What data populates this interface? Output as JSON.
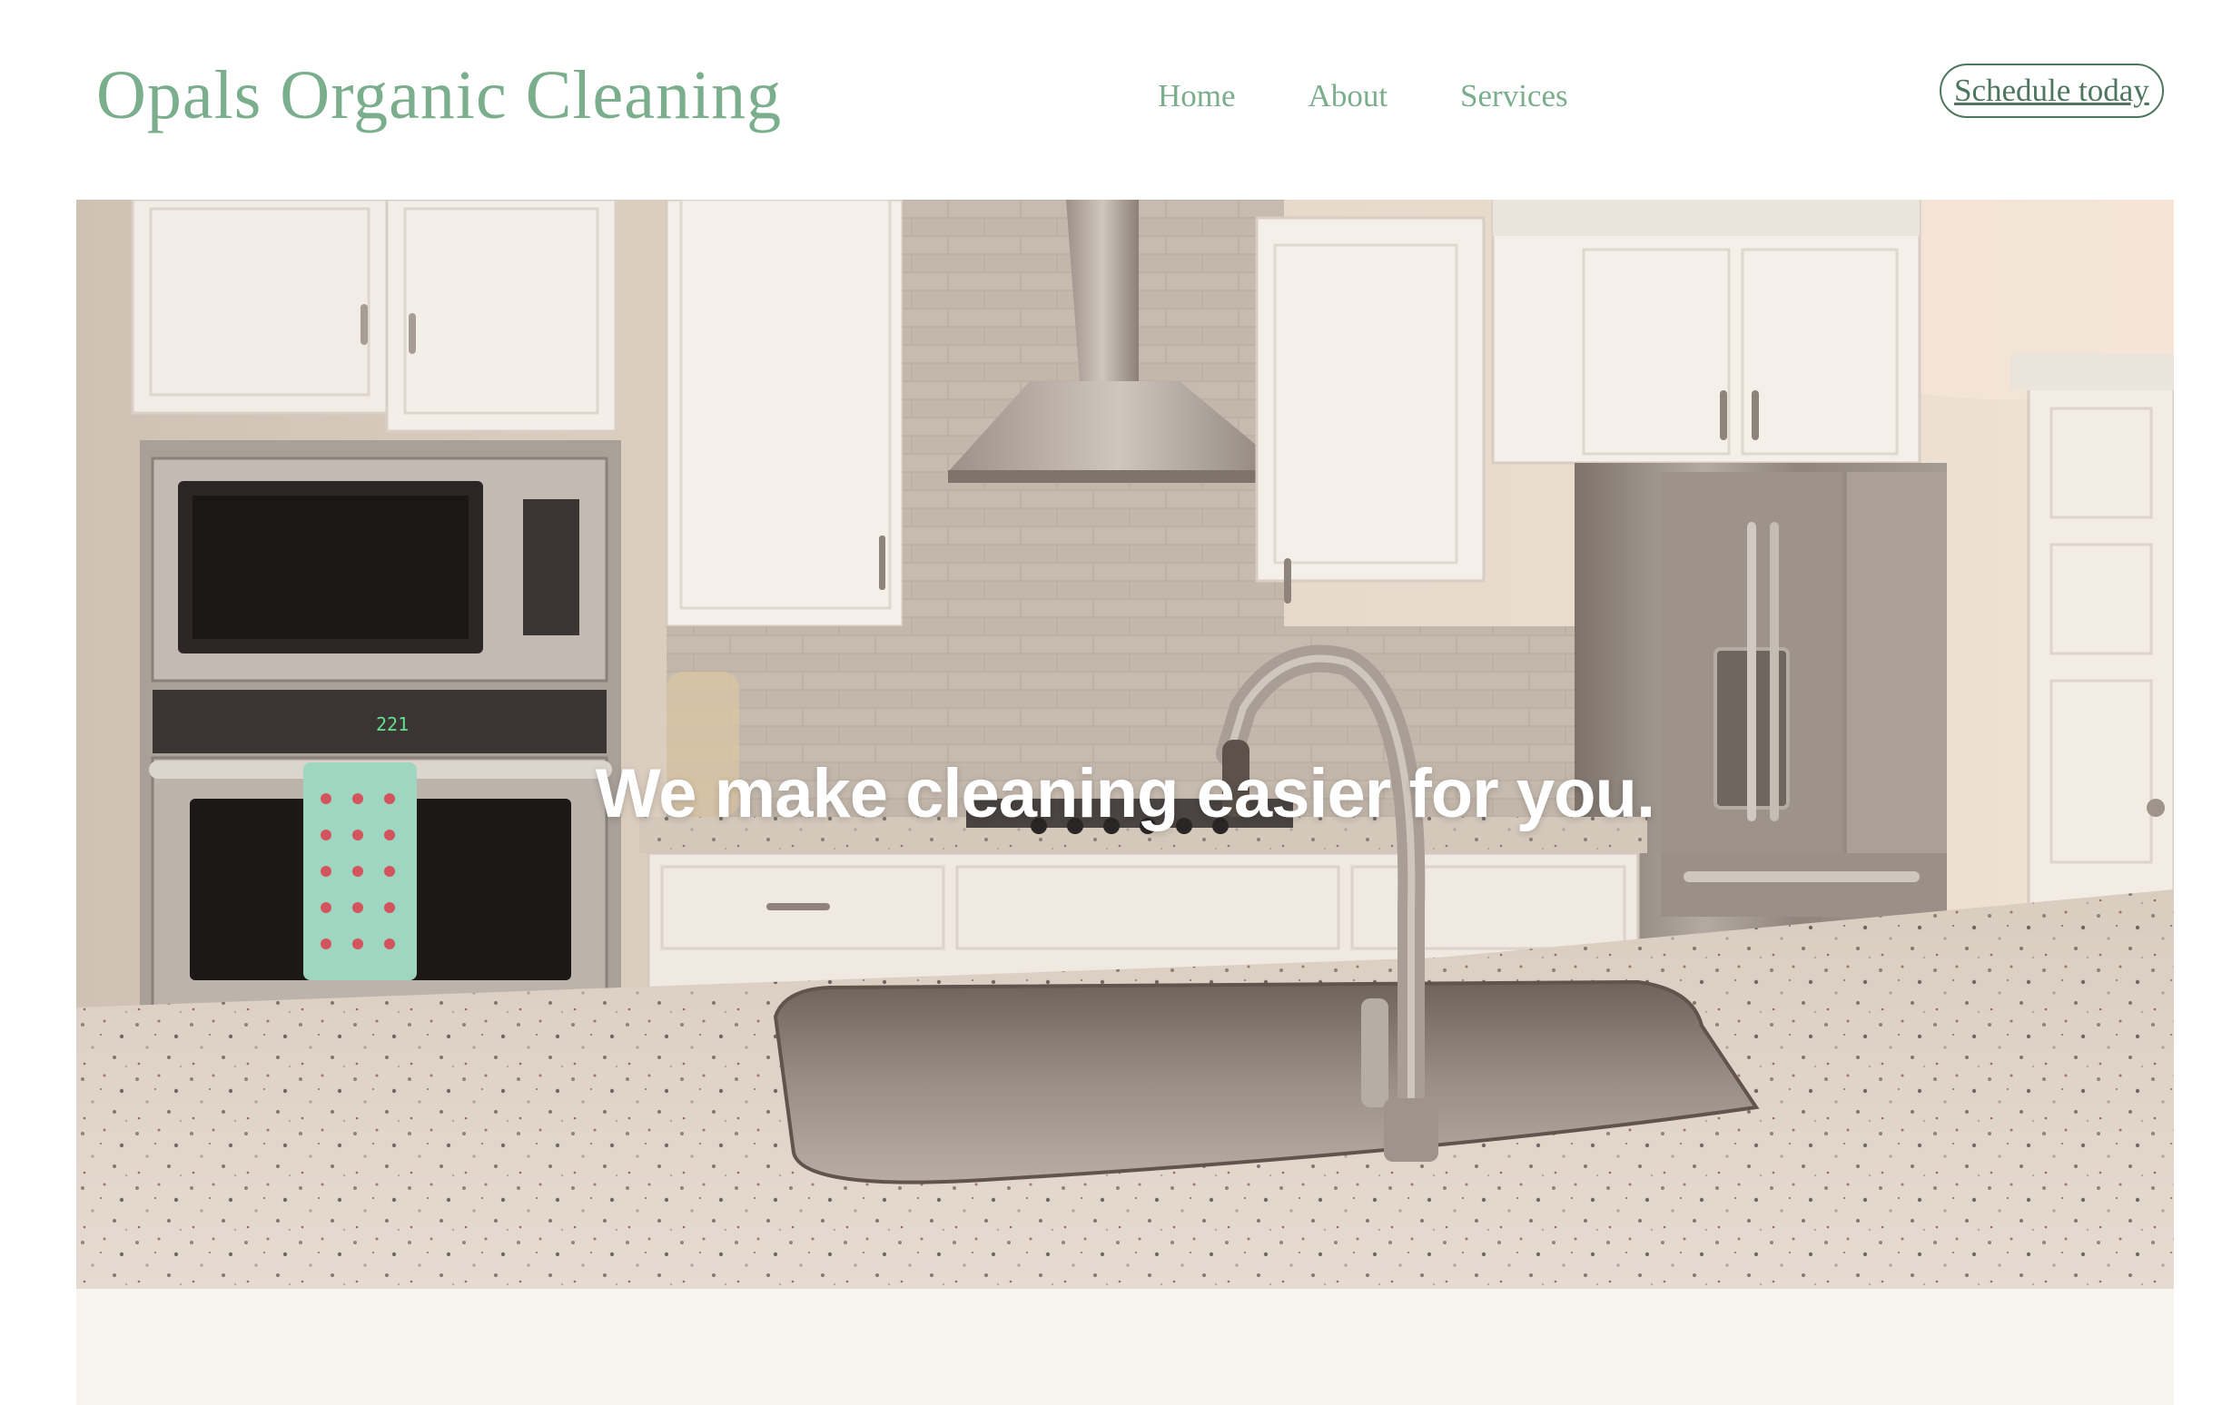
{
  "header": {
    "brand": "Opals Organic Cleaning",
    "nav": [
      {
        "label": "Home"
      },
      {
        "label": "About"
      },
      {
        "label": "Services"
      }
    ],
    "cta_label": "Schedule today"
  },
  "hero": {
    "headline": "We make cleaning easier for you.",
    "image_subject": "kitchen with granite island and stainless steel sink",
    "oven_display": "221"
  },
  "colors": {
    "brand_green": "#7aae8c",
    "cta_border": "#4d7660",
    "lower_section_bg": "#f8f5f0",
    "headline": "#ffffff"
  }
}
